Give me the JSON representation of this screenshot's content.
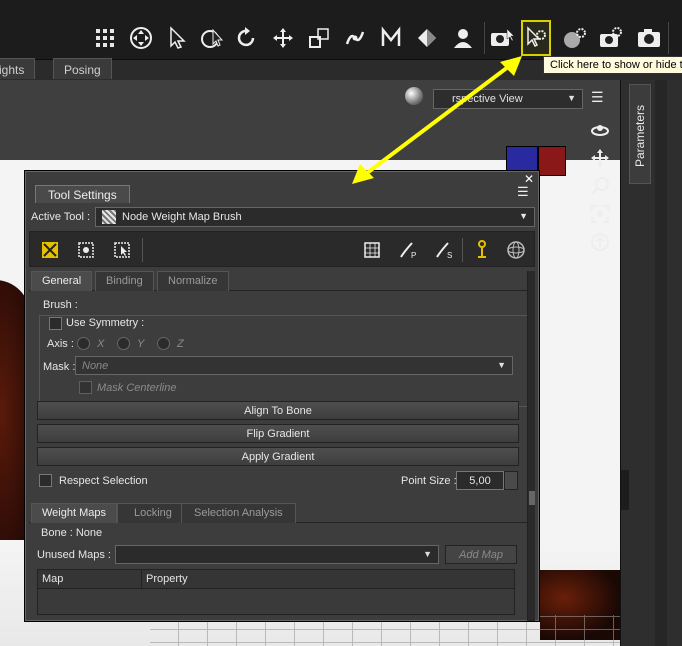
{
  "toolbar": {
    "tooltip": "Click here to show or hide t",
    "icons": [
      "grid-icon",
      "node-nav-icon",
      "pointer-icon",
      "universal-icon",
      "rotate-icon",
      "translate-icon",
      "scale-icon",
      "joint-editor-icon",
      "morph-brush-icon",
      "geometry-icon",
      "figure-icon",
      "camera-pointer-icon",
      "tool-settings-icon",
      "render-icon",
      "render-settings-icon",
      "camera-icon"
    ]
  },
  "main_tabs": [
    {
      "label": "ights"
    },
    {
      "label": "Posing"
    }
  ],
  "viewport": {
    "view_label": "rspective View"
  },
  "right_dock": {
    "tab_label": "Parameters"
  },
  "tool_settings": {
    "title": "Tool Settings",
    "active_tool_label": "Active Tool :",
    "active_tool_value": "Node Weight Map Brush",
    "tabs": [
      {
        "label": "General"
      },
      {
        "label": "Binding"
      },
      {
        "label": "Normalize"
      }
    ],
    "brush": {
      "label": "Brush :",
      "use_symmetry": "Use Symmetry :",
      "axis_label": "Axis :",
      "axis_x": "X",
      "axis_y": "Y",
      "axis_z": "Z",
      "mask_label": "Mask :",
      "mask_value": "None",
      "mask_centerline": "Mask Centerline"
    },
    "buttons": {
      "align_to_bone": "Align To Bone",
      "flip_gradient": "Flip Gradient",
      "apply_gradient": "Apply Gradient"
    },
    "respect_selection": "Respect Selection",
    "point_size_label": "Point Size :",
    "point_size_value": "5,00",
    "lower_tabs": [
      {
        "label": "Weight Maps"
      },
      {
        "label": "Locking"
      },
      {
        "label": "Selection Analysis"
      }
    ],
    "bone_label": "Bone : None",
    "unused_maps_label": "Unused Maps :",
    "unused_maps_value": "",
    "add_map": "Add Map",
    "table": {
      "col_map": "Map",
      "col_property": "Property"
    }
  },
  "colors": {
    "highlight": "#d8d000",
    "arrow": "#ffff00",
    "tooltip_bg": "#fffbdc"
  }
}
